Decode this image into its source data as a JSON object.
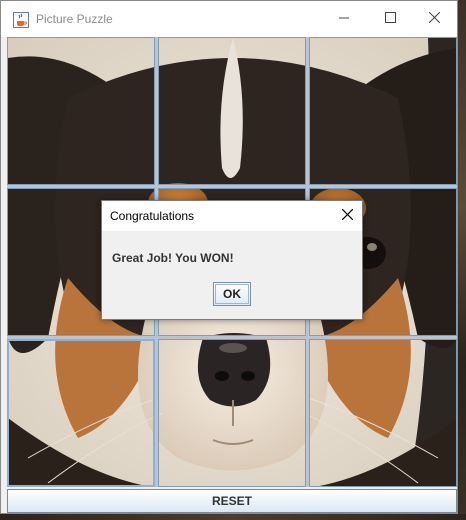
{
  "window": {
    "title": "Picture Puzzle",
    "icon": "java-cup-icon",
    "controls": [
      "minimize-icon",
      "maximize-icon",
      "close-icon"
    ]
  },
  "puzzle": {
    "grid": "3x3",
    "image": "puppy face",
    "tiles": [
      "tile-1",
      "tile-2",
      "tile-3",
      "tile-4",
      "tile-5",
      "tile-6",
      "tile-7",
      "tile-8",
      "tile-9"
    ],
    "selected_tile": 7
  },
  "reset_button": {
    "label": "RESET"
  },
  "dialog": {
    "title": "Congratulations",
    "message": "Great Job! You WON!",
    "ok_label": "OK",
    "close_icon": "close-icon"
  },
  "colors": {
    "tile_border": "#7f9db9",
    "button_gradient_bottom": "#dbe7f3",
    "title_text": "#8c8c8c"
  }
}
